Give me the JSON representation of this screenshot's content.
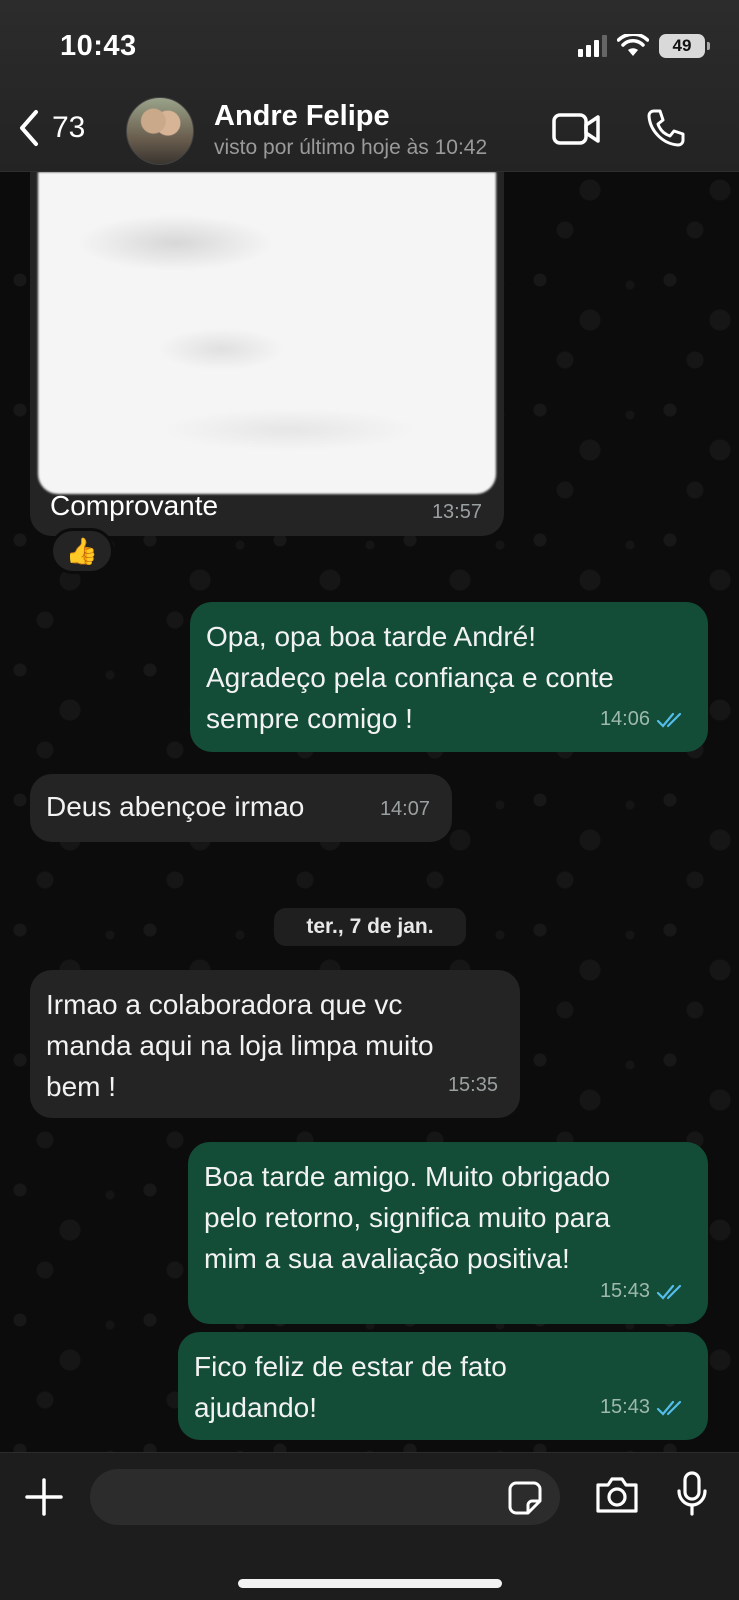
{
  "status_bar": {
    "time": "10:43",
    "battery": "49"
  },
  "header": {
    "back_count": "73",
    "contact_name": "Andre Felipe",
    "contact_status": "visto por último hoje às 10:42"
  },
  "messages": [
    {
      "id": "m0",
      "direction": "in",
      "type": "image",
      "caption": "Comprovante",
      "time": "13:57",
      "reaction": "👍"
    },
    {
      "id": "m1",
      "direction": "out",
      "text": "Opa, opa boa tarde André!\nAgradeço pela confiança e conte\nsempre comigo !",
      "time": "14:06",
      "read": true
    },
    {
      "id": "m2",
      "direction": "in",
      "text": "Deus abençoe irmao",
      "time": "14:07"
    },
    {
      "id": "m3",
      "direction": "in",
      "text": "Irmao a colaboradora que vc\nmanda aqui na loja limpa muito\nbem !",
      "time": "15:35"
    },
    {
      "id": "m4",
      "direction": "out",
      "text": "Boa tarde amigo. Muito obrigado\npelo retorno, significa muito para\nmim a sua avaliação positiva!",
      "time": "15:43",
      "read": true
    },
    {
      "id": "m5",
      "direction": "out",
      "text": "Fico feliz de estar de fato\najudando!",
      "time": "15:43",
      "read": true
    }
  ],
  "date_separator": "ter., 7 de jan.",
  "colors": {
    "incoming_bubble": "#242424",
    "outgoing_bubble": "#134d37",
    "read_ticks": "#53bdeb"
  },
  "icons": {
    "header": [
      "chevron-left-icon",
      "video-call-icon",
      "phone-icon"
    ],
    "footer": [
      "plus-icon",
      "sticker-icon",
      "camera-icon",
      "microphone-icon"
    ]
  }
}
